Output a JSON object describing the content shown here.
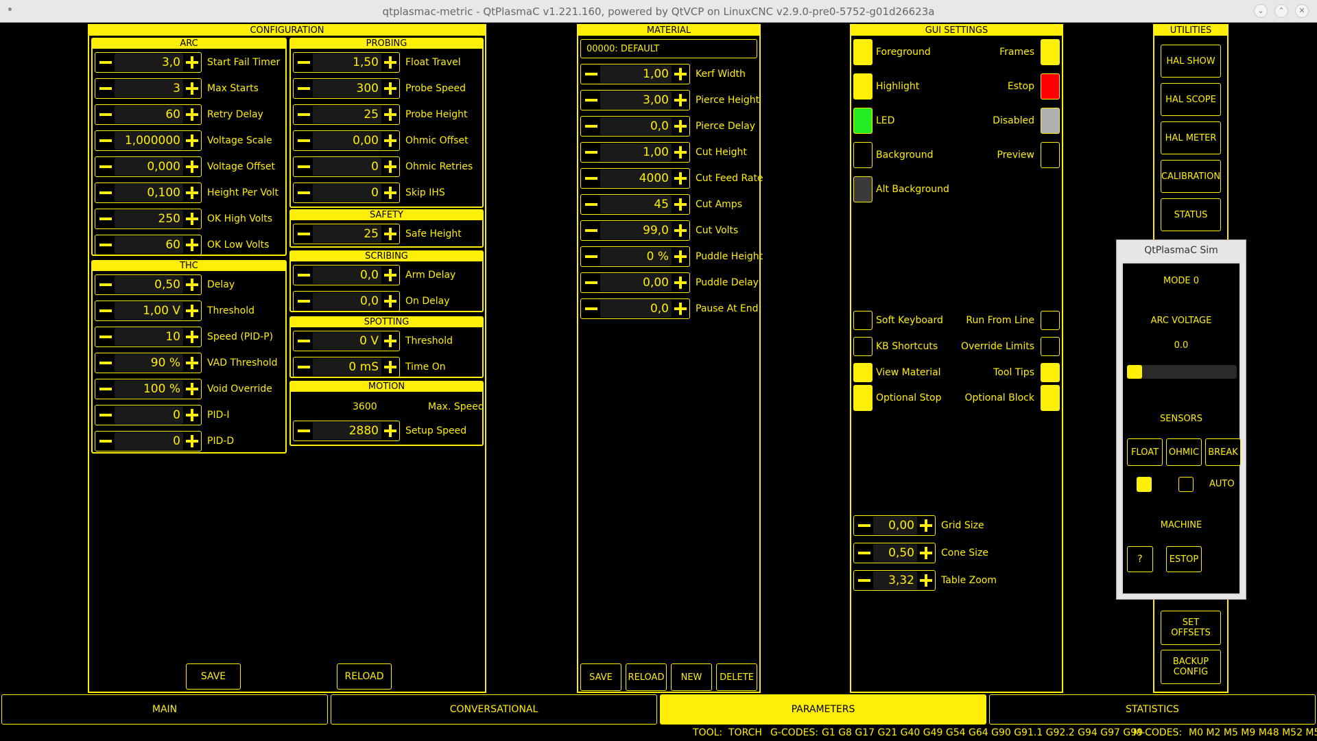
{
  "window": {
    "title": "qtplasmac-metric - QtPlasmaC v1.221.160, powered by QtVCP on LinuxCNC v2.9.0-pre0-5752-g01d26623a"
  },
  "configuration": {
    "title": "CONFIGURATION",
    "arc": {
      "title": "ARC",
      "rows": [
        {
          "value": "3,0",
          "label": "Start Fail Timer"
        },
        {
          "value": "3",
          "label": "Max Starts"
        },
        {
          "value": "60",
          "label": "Retry Delay"
        },
        {
          "value": "1,000000",
          "label": "Voltage Scale"
        },
        {
          "value": "0,000",
          "label": "Voltage Offset"
        },
        {
          "value": "0,100",
          "label": "Height Per Volt"
        },
        {
          "value": "250",
          "label": "OK High Volts"
        },
        {
          "value": "60",
          "label": "OK Low Volts"
        }
      ]
    },
    "thc": {
      "title": "THC",
      "rows": [
        {
          "value": "0,50",
          "label": "Delay"
        },
        {
          "value": "1,00 V",
          "label": "Threshold"
        },
        {
          "value": "10",
          "label": "Speed (PID-P)"
        },
        {
          "value": "90 %",
          "label": "VAD Threshold"
        },
        {
          "value": "100 %",
          "label": "Void Override"
        },
        {
          "value": "0",
          "label": "PID-I"
        },
        {
          "value": "0",
          "label": "PID-D"
        }
      ]
    },
    "probing": {
      "title": "PROBING",
      "rows": [
        {
          "value": "1,50",
          "label": "Float Travel"
        },
        {
          "value": "300",
          "label": "Probe Speed"
        },
        {
          "value": "25",
          "label": "Probe Height"
        },
        {
          "value": "0,00",
          "label": "Ohmic Offset"
        },
        {
          "value": "0",
          "label": "Ohmic Retries"
        },
        {
          "value": "0",
          "label": "Skip IHS"
        }
      ]
    },
    "safety": {
      "title": "SAFETY",
      "rows": [
        {
          "value": "25",
          "label": "Safe Height"
        }
      ]
    },
    "scribing": {
      "title": "SCRIBING",
      "rows": [
        {
          "value": "0,0",
          "label": "Arm Delay"
        },
        {
          "value": "0,0",
          "label": "On Delay"
        }
      ]
    },
    "spotting": {
      "title": "SPOTTING",
      "rows": [
        {
          "value": "0 V",
          "label": "Threshold"
        },
        {
          "value": "0 mS",
          "label": "Time On"
        }
      ]
    },
    "motion": {
      "title": "MOTION",
      "max_speed_value": "3600",
      "max_speed_label": "Max. Speed",
      "setup_value": "2880",
      "setup_label": "Setup Speed"
    },
    "save_label": "SAVE",
    "reload_label": "RELOAD"
  },
  "material": {
    "title": "MATERIAL",
    "selected": "00000: DEFAULT",
    "rows": [
      {
        "value": "1,00",
        "label": "Kerf Width"
      },
      {
        "value": "3,00",
        "label": "Pierce Height"
      },
      {
        "value": "0,0",
        "label": "Pierce Delay"
      },
      {
        "value": "1,00",
        "label": "Cut Height"
      },
      {
        "value": "4000",
        "label": "Cut Feed Rate"
      },
      {
        "value": "45",
        "label": "Cut Amps"
      },
      {
        "value": "99,0",
        "label": "Cut Volts"
      },
      {
        "value": "0 %",
        "label": "Puddle Height"
      },
      {
        "value": "0,00",
        "label": "Puddle Delay"
      },
      {
        "value": "0,0",
        "label": "Pause At End"
      }
    ],
    "buttons": [
      "SAVE",
      "RELOAD",
      "NEW",
      "DELETE"
    ]
  },
  "gui": {
    "title": "GUI SETTINGS",
    "colors_left": [
      {
        "label": "Foreground",
        "color": "#ffee06"
      },
      {
        "label": "Highlight",
        "color": "#ffee06"
      },
      {
        "label": "LED",
        "color": "#22ee22"
      },
      {
        "label": "Background",
        "color": "#000000"
      },
      {
        "label": "Alt Background",
        "color": "#3a3a3a"
      }
    ],
    "colors_right": [
      {
        "label": "Frames",
        "color": "#ffee06"
      },
      {
        "label": "Estop",
        "color": "#ff0000"
      },
      {
        "label": "Disabled",
        "color": "#b0b0b0"
      },
      {
        "label": "Preview",
        "color": "#000000"
      }
    ],
    "checks_left": [
      {
        "label": "Soft Keyboard",
        "checked": false
      },
      {
        "label": "KB Shortcuts",
        "checked": false
      },
      {
        "label": "View Material",
        "checked": true
      },
      {
        "label": "Optional Stop",
        "checked": true
      }
    ],
    "checks_right": [
      {
        "label": "Run From Line",
        "checked": false
      },
      {
        "label": "Override Limits",
        "checked": false
      },
      {
        "label": "Tool Tips",
        "checked": true
      },
      {
        "label": "Optional Block",
        "checked": true
      }
    ],
    "spins": [
      {
        "value": "0,00",
        "label": "Grid Size"
      },
      {
        "value": "0,50",
        "label": "Cone Size"
      },
      {
        "value": "3,32",
        "label": "Table Zoom"
      }
    ]
  },
  "utilities": {
    "title": "UTILITIES",
    "buttons": [
      "HAL SHOW",
      "HAL SCOPE",
      "HAL METER",
      "CALIBRATION",
      "STATUS"
    ],
    "set_offsets": "SET\nOFFSETS",
    "backup": "BACKUP\nCONFIG"
  },
  "sim": {
    "title": "QtPlasmaC Sim",
    "mode": "MODE 0",
    "arc_voltage_label": "ARC VOLTAGE",
    "arc_voltage_value": "0.0",
    "slider_fraction": 0.0,
    "sensors_label": "SENSORS",
    "float_btn": "FLOAT",
    "ohmic_btn": "OHMIC",
    "break_btn": "BREAK",
    "auto_label": "AUTO",
    "machine_label": "MACHINE",
    "q_btn": "?",
    "estop_btn": "ESTOP"
  },
  "tabs": [
    "MAIN",
    "CONVERSATIONAL",
    "PARAMETERS",
    "STATISTICS"
  ],
  "active_tab": "PARAMETERS",
  "status": {
    "tool_label": "TOOL:",
    "tool_value": "TORCH",
    "gcodes_label": "G-CODES:",
    "gcodes_value": "G1 G8 G17 G21 G40 G49 G54 G64 G90 G91.1 G92.2 G94 G97 G99",
    "mcodes_label": "M-CODES:",
    "mcodes_value": "M0 M2 M5 M9 M48 M52 M53"
  }
}
